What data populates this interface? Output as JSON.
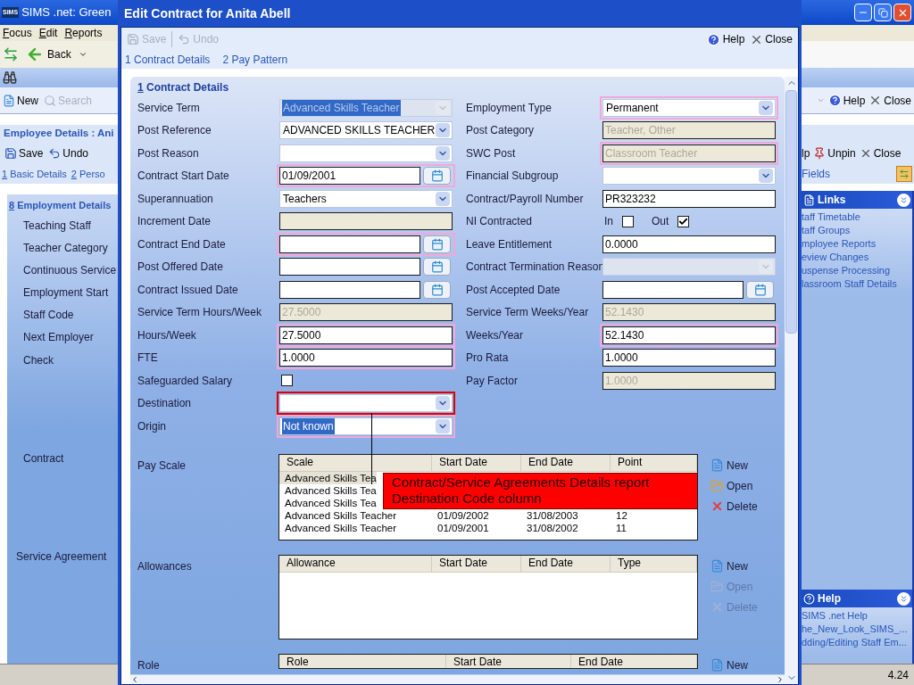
{
  "background_window": {
    "badge": "SIMS",
    "title": "SIMS .net: Green",
    "menu": [
      "Focus",
      "Edit",
      "Reports"
    ],
    "back": "Back",
    "toolbar": [
      {
        "label": "New",
        "disabled": false
      },
      {
        "label": "Search",
        "disabled": true
      }
    ],
    "toolbar_right": [
      "Help",
      "Close"
    ],
    "employee_title": "Employee Details : Ani",
    "employee_toolbar": [
      "Save",
      "Undo"
    ],
    "employee_toolbar_right": [
      "lp",
      "Unpin",
      "Close"
    ],
    "tabs": [
      {
        "number": "1",
        "label": "Basic Details"
      },
      {
        "number": "2",
        "label": "Perso"
      }
    ],
    "tabs_right": "Fields",
    "section": {
      "number": "8",
      "title": "Employment Details"
    },
    "section_items": [
      {
        "label": "Teaching Staff",
        "kind": "field"
      },
      {
        "label": "Teacher Category",
        "kind": "field"
      },
      {
        "label": "Continuous Service",
        "kind": "field"
      },
      {
        "label": "Employment Start",
        "kind": "field"
      },
      {
        "label": "Staff Code",
        "kind": "field"
      },
      {
        "label": "Next Employer",
        "kind": "field"
      },
      {
        "label": "Check",
        "kind": "group"
      },
      {
        "label": "Contract",
        "kind": "group"
      },
      {
        "label": "Service Agreement",
        "kind": "outer"
      }
    ],
    "links": {
      "title": "Links",
      "items": [
        "taff Timetable",
        "taff Groups",
        "mployee Reports",
        "eview Changes",
        "uspense Processing",
        "lassroom Staff Details"
      ]
    },
    "help": {
      "title": "Help",
      "items": [
        "SIMS .net Help",
        "he_New_Look_SIMS_...",
        "dding/Editing Staff Em..."
      ]
    },
    "status": "4.24"
  },
  "dialog": {
    "title": "Edit Contract for Anita Abell",
    "toolbar": [
      {
        "label": "Save",
        "disabled": true
      },
      {
        "label": "Undo",
        "disabled": true
      }
    ],
    "help": "Help",
    "close": "Close",
    "tabs": [
      "1 Contract Details",
      "2 Pay Pattern"
    ],
    "section": {
      "number": "1",
      "title": "Contract Details"
    },
    "left_fields": [
      {
        "label": "Service Term",
        "kind": "combo",
        "value": "Advanced Skills Teacher",
        "value_selected": true,
        "disabled": true,
        "outlined": false,
        "error": false
      },
      {
        "label": "Post Reference",
        "kind": "combo",
        "value": "ADVANCED SKILLS TEACHER",
        "value_selected": false,
        "disabled": false,
        "outlined": false,
        "error": false
      },
      {
        "label": "Post Reason",
        "kind": "combo",
        "disabled": false,
        "outlined": false,
        "error": false
      },
      {
        "label": "Contract Start Date",
        "kind": "date",
        "value": "01/09/2001",
        "disabled": false,
        "outlined": true,
        "error": false
      },
      {
        "label": "Superannuation",
        "kind": "combo",
        "value": "Teachers",
        "value_selected": false,
        "disabled": false,
        "outlined": false,
        "error": false
      },
      {
        "label": "Increment Date",
        "kind": "text",
        "disabled": true,
        "outlined": false,
        "error": false
      },
      {
        "label": "Contract End Date",
        "kind": "date",
        "disabled": false,
        "outlined": true,
        "error": false
      },
      {
        "label": "Post Offered Date",
        "kind": "date",
        "disabled": false,
        "outlined": false,
        "error": false
      },
      {
        "label": "Contract Issued Date",
        "kind": "date",
        "disabled": false,
        "outlined": false,
        "error": false
      },
      {
        "label": "Service Term Hours/Week",
        "kind": "text",
        "value": "27.5000",
        "disabled": true,
        "outlined": false,
        "error": false
      },
      {
        "label": "Hours/Week",
        "kind": "text",
        "value": "27.5000",
        "disabled": false,
        "outlined": true,
        "error": false
      },
      {
        "label": "FTE",
        "kind": "text",
        "value": "1.0000",
        "disabled": false,
        "outlined": true,
        "error": false
      },
      {
        "label": "Safeguarded Salary",
        "kind": "checkbox",
        "checked": false,
        "disabled": false,
        "outlined": false,
        "error": false
      },
      {
        "label": "Destination",
        "kind": "combo",
        "disabled": false,
        "outlined": false,
        "error": true
      },
      {
        "label": "Origin",
        "kind": "combo",
        "value": "Not known",
        "value_selected": true,
        "disabled": false,
        "outlined": true,
        "error": false
      }
    ],
    "right_fields": [
      {
        "label": "Employment Type",
        "kind": "combo",
        "value": "Permanent",
        "value_selected": false,
        "disabled": false,
        "outlined": true,
        "error": false
      },
      {
        "label": "Post Category",
        "kind": "text",
        "value": "Teacher, Other",
        "disabled": true,
        "outlined": false,
        "error": false
      },
      {
        "label": "SWC Post",
        "kind": "text",
        "value": "Classroom Teacher",
        "disabled": true,
        "outlined": true,
        "error": false
      },
      {
        "label": "Financial Subgroup",
        "kind": "combo",
        "disabled": false,
        "outlined": false,
        "error": false
      },
      {
        "label": "Contract/Payroll Number",
        "kind": "text",
        "value": "PR323232",
        "disabled": false,
        "outlined": false,
        "error": false
      },
      {
        "label": "NI Contracted",
        "kind": "ni",
        "options": [
          {
            "label": "In",
            "checked": false
          },
          {
            "label": "Out",
            "checked": true
          }
        ],
        "disabled": false,
        "outlined": false,
        "error": false
      },
      {
        "label": "Leave Entitlement",
        "kind": "text",
        "value": "0.0000",
        "disabled": false,
        "outlined": false,
        "error": false
      },
      {
        "label": "Contract Termination Reason",
        "kind": "combo",
        "disabled": true,
        "outlined": false,
        "error": false
      },
      {
        "label": "Post Accepted Date",
        "kind": "date",
        "disabled": false,
        "outlined": false,
        "error": false
      },
      {
        "label": "Service Term Weeks/Year",
        "kind": "text",
        "value": "52.1430",
        "disabled": true,
        "outlined": false,
        "error": false
      },
      {
        "label": "Weeks/Year",
        "kind": "text",
        "value": "52.1430",
        "disabled": false,
        "outlined": true,
        "error": false
      },
      {
        "label": "Pro Rata",
        "kind": "text",
        "value": "1.0000",
        "disabled": false,
        "outlined": false,
        "error": false
      },
      {
        "label": "Pay Factor",
        "kind": "text",
        "value": "1.0000",
        "disabled": true,
        "outlined": false,
        "error": false
      }
    ],
    "tables": [
      {
        "label": "Pay Scale",
        "columns": [
          "Scale",
          "Start Date",
          "End Date",
          "Point"
        ],
        "rows": [
          {
            "cells": [
              "Advanced Skills Tea"
            ],
            "selected": true
          },
          {
            "cells": [
              "Advanced Skills Tea"
            ],
            "selected": false
          },
          {
            "cells": [
              "Advanced Skills Tea"
            ],
            "selected": false
          },
          {
            "cells": [
              "Advanced Skills Teacher",
              "01/09/2002",
              "31/08/2003",
              "12"
            ],
            "selected": false
          },
          {
            "cells": [
              "Advanced Skills Teacher",
              "01/09/2001",
              "31/08/2002",
              "11"
            ],
            "selected": false
          }
        ],
        "actions": [
          {
            "kind": "new",
            "label": "New",
            "disabled": false
          },
          {
            "kind": "open",
            "label": "Open",
            "disabled": false
          },
          {
            "kind": "delete",
            "label": "Delete",
            "disabled": false
          }
        ]
      },
      {
        "label": "Allowances",
        "columns": [
          "Allowance",
          "Start Date",
          "End Date",
          "Type"
        ],
        "actions": [
          {
            "kind": "new",
            "label": "New",
            "disabled": false
          },
          {
            "kind": "open",
            "label": "Open",
            "disabled": true
          },
          {
            "kind": "delete",
            "label": "Delete",
            "disabled": true
          }
        ]
      },
      {
        "label": "Role",
        "columns": [
          "Role",
          "Start Date",
          "End Date"
        ],
        "actions": [
          {
            "kind": "new",
            "label": "New",
            "disabled": false
          }
        ]
      }
    ],
    "annotation": "Contract/Service Agreements Details report Destination Code column"
  }
}
